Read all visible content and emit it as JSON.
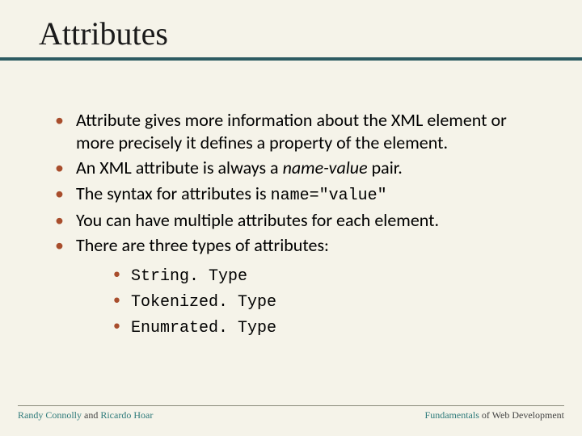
{
  "title": "Attributes",
  "bullets": [
    {
      "pre": "Attribute gives more information about the XML element or more precisely it defines a property of the element."
    },
    {
      "pre": "An XML attribute is always a ",
      "ital": "name-value",
      "post": " pair."
    },
    {
      "pre": "The syntax for attributes is ",
      "code": "name=\"value\""
    },
    {
      "pre": "You can have multiple attributes for each element."
    },
    {
      "pre": "There are three types of attributes:"
    }
  ],
  "subbullets": [
    "String. Type",
    "Tokenized. Type",
    "Enumrated. Type"
  ],
  "footer": {
    "left_a1": "Randy Connolly",
    "left_mid": " and ",
    "left_a2": "Ricardo Hoar",
    "right_a": "Fundamentals",
    "right_rest": " of Web Development"
  }
}
